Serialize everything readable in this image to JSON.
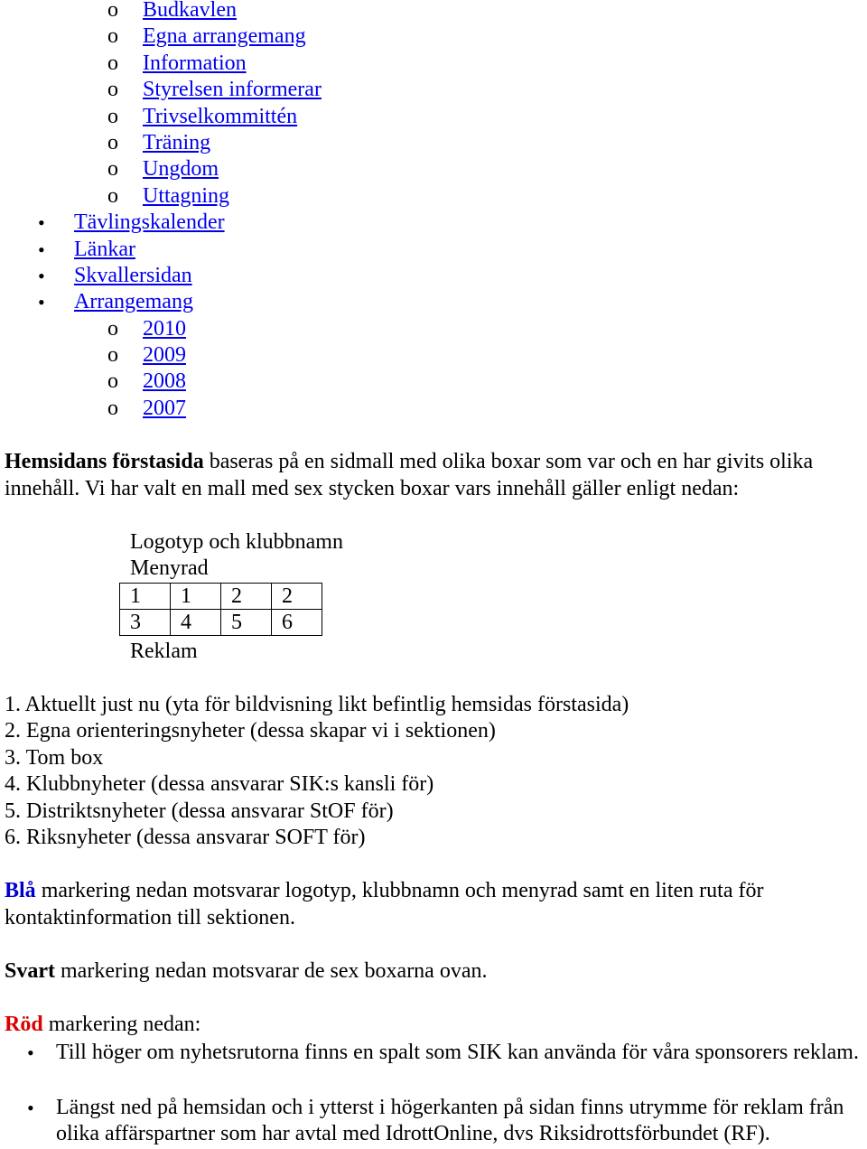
{
  "nav": {
    "group1_sub": [
      "Budkavlen",
      "Egna arrangemang",
      "Information",
      "Styrelsen informerar",
      "Trivselkommittén",
      "Träning",
      "Ungdom",
      "Uttagning"
    ],
    "top_items": [
      "Tävlingskalender",
      "Länkar",
      "Skvallersidan",
      "Arrangemang"
    ],
    "arrangemang_sub": [
      "2010",
      "2009",
      "2008",
      "2007"
    ],
    "sub_marker": "o",
    "bullet_marker": "•"
  },
  "intro": {
    "bold": "Hemsidans förstasida",
    "rest": " baseras på en sidmall med olika boxar som var och en har givits olika innehåll. Vi har valt en mall med sex stycken boxar vars innehåll gäller enligt nedan:"
  },
  "layout": {
    "logo_label": "Logotyp och klubbnamn",
    "menu_label": "Menyrad",
    "grid": [
      [
        "1",
        "1",
        "2",
        "2"
      ],
      [
        "3",
        "4",
        "5",
        "6"
      ]
    ],
    "ad_label": "Reklam"
  },
  "boxes": [
    "1. Aktuellt just nu (yta för bildvisning likt befintlig hemsidas förstasida)",
    "2. Egna orienteringsnyheter (dessa skapar vi i sektionen)",
    "3. Tom box",
    "4. Klubbnyheter (dessa ansvarar SIK:s kansli för)",
    "5. Distriktsnyheter (dessa ansvarar StOF för)",
    "6. Riksnyheter (dessa ansvarar SOFT för)"
  ],
  "blue": {
    "word": "Blå",
    "rest": " markering nedan motsvarar logotyp, klubbnamn och menyrad samt en liten ruta för kontaktinformation till sektionen.",
    "color": "#0000cc"
  },
  "black": {
    "word": "Svart",
    "rest": " markering nedan motsvarar de sex boxarna ovan."
  },
  "red": {
    "word": "Röd",
    "rest": " markering nedan:",
    "color": "#dd0000",
    "items": [
      "Till höger om nyhetsrutorna finns en spalt som SIK kan använda för våra sponsorers reklam.",
      "Längst ned på hemsidan och i ytterst i högerkanten på sidan finns utrymme för reklam från olika affärspartner som har avtal med IdrottOnline, dvs Riksidrottsförbundet (RF)."
    ]
  }
}
